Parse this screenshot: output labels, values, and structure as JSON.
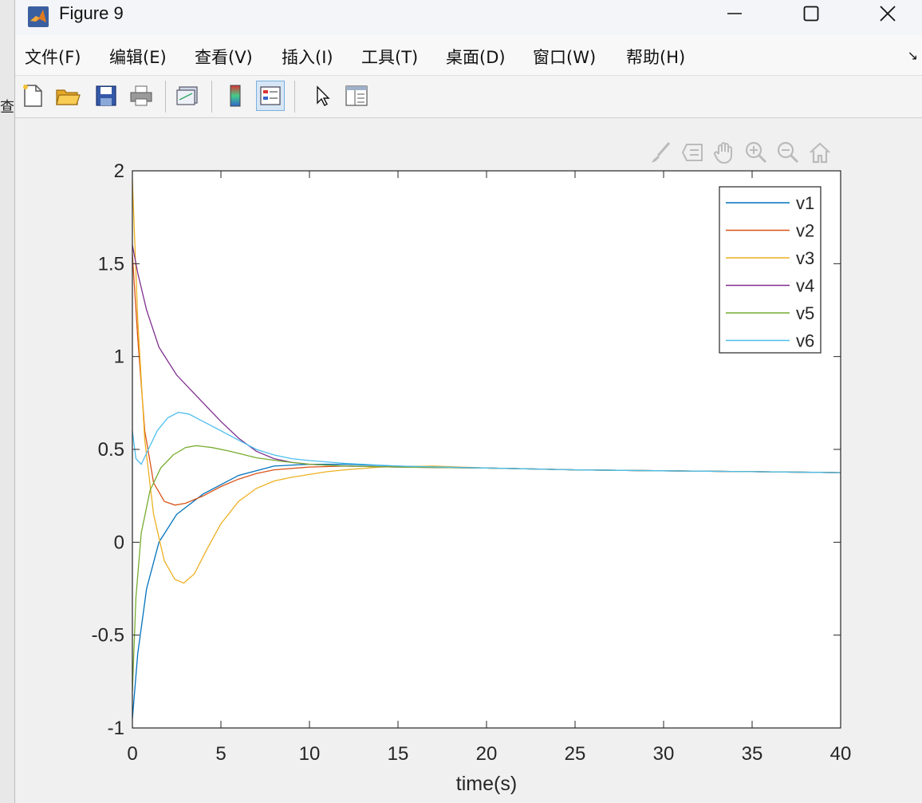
{
  "window": {
    "title": "Figure 9",
    "background_fragment": "查"
  },
  "menu": {
    "items": [
      "文件(F)",
      "编辑(E)",
      "查看(V)",
      "插入(I)",
      "工具(T)",
      "桌面(D)",
      "窗口(W)",
      "帮助(H)"
    ],
    "more": "↘"
  },
  "toolbar": {
    "icons": [
      "new-figure-icon",
      "open-file-icon",
      "save-icon",
      "print-icon",
      "link-plot-icon",
      "colorbar-icon",
      "legend-icon",
      "edit-plot-icon",
      "property-inspector-icon"
    ]
  },
  "axes_toolbar": {
    "icons": [
      "brush-icon",
      "data-tips-icon",
      "pan-icon",
      "zoom-in-icon",
      "zoom-out-icon",
      "home-icon"
    ]
  },
  "chart_data": {
    "type": "line",
    "title": "",
    "xlabel": "time(s)",
    "ylabel": "",
    "xlim": [
      0,
      40
    ],
    "ylim": [
      -1,
      2
    ],
    "xticks": [
      "0",
      "5",
      "10",
      "15",
      "20",
      "25",
      "30",
      "35",
      "40"
    ],
    "yticks": [
      "2",
      "1.5",
      "1",
      "0.5",
      "0",
      "-0.5",
      "-1"
    ],
    "legend_position": "top-right",
    "grid": false,
    "series": [
      {
        "name": "v1",
        "color": "#0072BD",
        "x": [
          0,
          0.3,
          0.8,
          1.5,
          2.5,
          4,
          6,
          8,
          10,
          12,
          15,
          20,
          25,
          30,
          35,
          40
        ],
        "y": [
          -0.95,
          -0.6,
          -0.25,
          0.0,
          0.15,
          0.26,
          0.36,
          0.41,
          0.42,
          0.42,
          0.41,
          0.4,
          0.39,
          0.385,
          0.38,
          0.375
        ]
      },
      {
        "name": "v2",
        "color": "#D95319",
        "x": [
          0,
          0.3,
          0.7,
          1.2,
          1.8,
          2.4,
          3.0,
          4,
          5,
          6,
          7,
          8,
          10,
          12,
          15,
          20,
          25,
          30,
          35,
          40
        ],
        "y": [
          1.55,
          1.1,
          0.6,
          0.32,
          0.22,
          0.2,
          0.21,
          0.25,
          0.3,
          0.34,
          0.37,
          0.39,
          0.405,
          0.41,
          0.405,
          0.4,
          0.39,
          0.385,
          0.38,
          0.375
        ]
      },
      {
        "name": "v3",
        "color": "#EDB120",
        "x": [
          0,
          0.3,
          0.7,
          1.2,
          1.8,
          2.4,
          2.9,
          3.5,
          4.2,
          5,
          6,
          7,
          8,
          9,
          10,
          11,
          12,
          14,
          17,
          20,
          25,
          30,
          35,
          40
        ],
        "y": [
          1.95,
          1.2,
          0.55,
          0.15,
          -0.1,
          -0.2,
          -0.22,
          -0.17,
          -0.04,
          0.1,
          0.22,
          0.29,
          0.33,
          0.35,
          0.365,
          0.38,
          0.39,
          0.405,
          0.41,
          0.4,
          0.39,
          0.385,
          0.38,
          0.375
        ]
      },
      {
        "name": "v4",
        "color": "#7E2F8E",
        "x": [
          0,
          0.3,
          0.8,
          1.5,
          2.5,
          3.5,
          5,
          6,
          7,
          8,
          9,
          10,
          12,
          15,
          20,
          25,
          30,
          35,
          40
        ],
        "y": [
          1.6,
          1.45,
          1.25,
          1.05,
          0.9,
          0.8,
          0.65,
          0.56,
          0.49,
          0.45,
          0.43,
          0.42,
          0.41,
          0.405,
          0.4,
          0.39,
          0.385,
          0.38,
          0.375
        ]
      },
      {
        "name": "v5",
        "color": "#77AC30",
        "x": [
          0,
          0.2,
          0.5,
          1.0,
          1.6,
          2.3,
          3.0,
          3.6,
          4.5,
          5.5,
          7,
          8.5,
          10,
          12,
          15,
          20,
          25,
          30,
          35,
          40
        ],
        "y": [
          -0.8,
          -0.3,
          0.05,
          0.28,
          0.4,
          0.47,
          0.51,
          0.52,
          0.51,
          0.49,
          0.455,
          0.435,
          0.42,
          0.41,
          0.405,
          0.4,
          0.39,
          0.385,
          0.38,
          0.375
        ]
      },
      {
        "name": "v6",
        "color": "#4DBEEE",
        "x": [
          0,
          0.2,
          0.5,
          0.9,
          1.4,
          2.0,
          2.6,
          3.2,
          4,
          5,
          6,
          7,
          8,
          9,
          10,
          12,
          15,
          20,
          25,
          30,
          35,
          40
        ],
        "y": [
          0.6,
          0.45,
          0.42,
          0.5,
          0.6,
          0.67,
          0.7,
          0.69,
          0.65,
          0.6,
          0.55,
          0.5,
          0.47,
          0.45,
          0.44,
          0.425,
          0.41,
          0.4,
          0.39,
          0.385,
          0.38,
          0.375
        ]
      }
    ]
  }
}
